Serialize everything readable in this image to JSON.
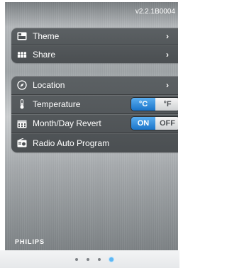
{
  "header": {
    "version": "v2.2.1B0004"
  },
  "groups": [
    {
      "items": [
        {
          "label": "Theme",
          "icon": "theme-icon",
          "has_arrow": true
        },
        {
          "label": "Share",
          "icon": "share-icon",
          "has_arrow": true
        }
      ]
    },
    {
      "items": [
        {
          "label": "Location",
          "icon": "compass-icon",
          "has_arrow": true
        },
        {
          "label": "Temperature",
          "icon": "thermometer-icon",
          "options": [
            "°C",
            "°F"
          ],
          "selected": "°C"
        },
        {
          "label": "Month/Day Revert",
          "icon": "calendar-icon",
          "options": [
            "ON",
            "OFF"
          ],
          "selected": "ON"
        },
        {
          "label": "Radio Auto Program",
          "icon": "radio-icon"
        }
      ]
    }
  ],
  "chevron": "›",
  "brand": "PHILIPS",
  "pager": {
    "count": 4,
    "active_index": 3
  },
  "colors": {
    "accent": "#1a74c9",
    "panel": "#4b4f52",
    "active_dot": "#5db7f4"
  }
}
